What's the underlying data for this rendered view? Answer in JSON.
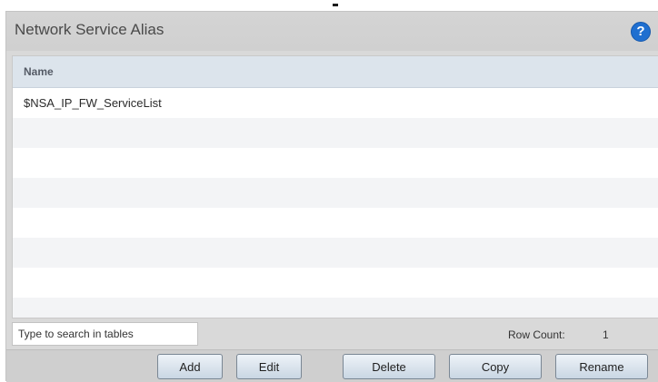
{
  "panel": {
    "title": "Network Service Alias",
    "help_icon": "question-circle-icon"
  },
  "table": {
    "columns": [
      {
        "label": "Name"
      }
    ],
    "rows": [
      {
        "name": "$NSA_IP_FW_ServiceList"
      },
      {
        "name": ""
      },
      {
        "name": ""
      },
      {
        "name": ""
      },
      {
        "name": ""
      },
      {
        "name": ""
      },
      {
        "name": ""
      },
      {
        "name": ""
      }
    ]
  },
  "footer": {
    "search_placeholder": "Type to search in tables",
    "search_value": "",
    "row_count_label": "Row Count:",
    "row_count_value": "1"
  },
  "buttons": {
    "add": "Add",
    "edit": "Edit",
    "delete": "Delete",
    "copy": "Copy",
    "rename": "Rename"
  },
  "colors": {
    "accent_help": "#1f6fd0",
    "header_bg": "#d4d4d4",
    "table_header_bg": "#dce4ec",
    "button_gradient_top": "#eef3f8",
    "button_gradient_bottom": "#c9d6e3"
  }
}
